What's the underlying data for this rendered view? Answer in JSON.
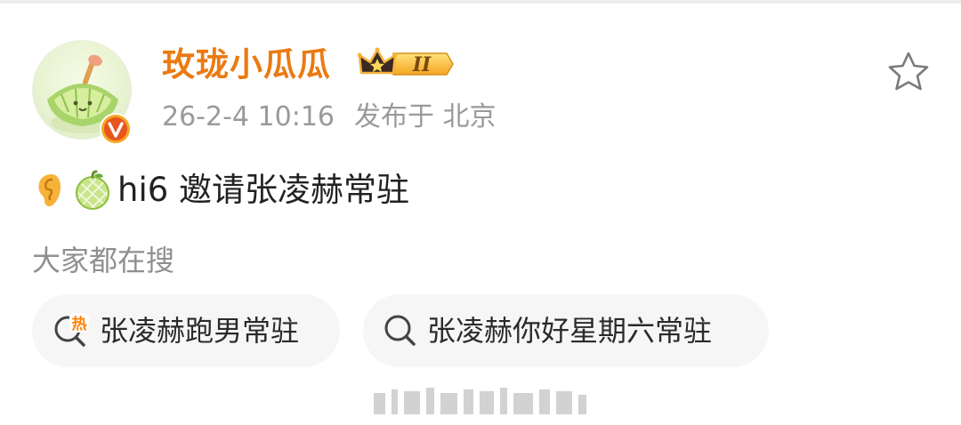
{
  "post": {
    "username": "玫珑小瓜瓜",
    "member_level": "II",
    "date": "26-2-4 10:16",
    "location": "发布于 北京",
    "text": "hi6 邀请张凌赫常驻"
  },
  "related": {
    "label": "大家都在搜",
    "items": [
      {
        "label": "张凌赫跑男常驻",
        "icon": "hot-search-icon"
      },
      {
        "label": "张凌赫你好星期六常驻",
        "icon": "search-icon"
      }
    ]
  },
  "colors": {
    "username": "#eb7a12",
    "meta": "#9a9a9a",
    "chip_bg": "#f6f6f6",
    "hot": "#ff8200",
    "verified": "#e8551f"
  }
}
